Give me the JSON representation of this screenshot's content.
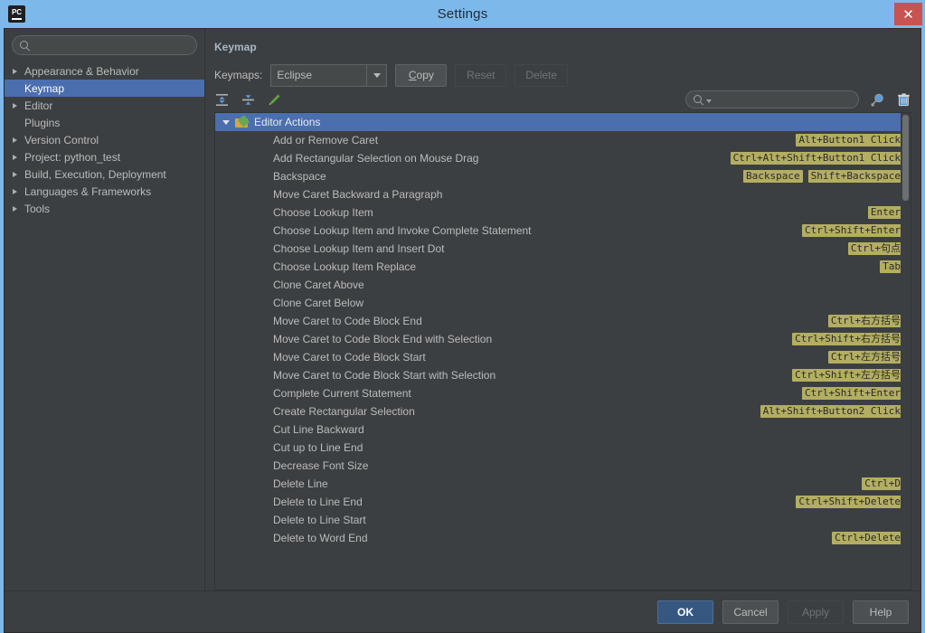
{
  "window": {
    "title": "Settings",
    "app_icon": "PC",
    "close_label": "✕"
  },
  "sidebar": {
    "search": {
      "value": "",
      "placeholder": ""
    },
    "items": [
      {
        "label": "Appearance & Behavior",
        "arrow": true,
        "selected": false
      },
      {
        "label": "Keymap",
        "arrow": false,
        "selected": true
      },
      {
        "label": "Editor",
        "arrow": true,
        "selected": false
      },
      {
        "label": "Plugins",
        "arrow": false,
        "selected": false
      },
      {
        "label": "Version Control",
        "arrow": true,
        "selected": false
      },
      {
        "label": "Project: python_test",
        "arrow": true,
        "selected": false
      },
      {
        "label": "Build, Execution, Deployment",
        "arrow": true,
        "selected": false
      },
      {
        "label": "Languages & Frameworks",
        "arrow": true,
        "selected": false
      },
      {
        "label": "Tools",
        "arrow": true,
        "selected": false
      }
    ]
  },
  "main": {
    "panel_title": "Keymap",
    "keymaps_label": "Keymaps:",
    "keymap_selected": "Eclipse",
    "buttons": {
      "copy_mnemonic": "C",
      "copy_rest": "opy",
      "reset": "Reset",
      "delete": "Delete"
    },
    "toolbar_icons": [
      "expand-all-icon",
      "collapse-all-icon",
      "edit-shortcut-icon"
    ],
    "tree_search": {
      "value": "",
      "placeholder": ""
    },
    "right_icons": [
      "find-by-shortcut-icon",
      "delete-shortcut-icon"
    ]
  },
  "tree": {
    "group": {
      "label": "Editor Actions",
      "expanded": true
    },
    "rows": [
      {
        "label": "Add or Remove Caret",
        "shortcuts": [
          "Alt+Button1 Click"
        ]
      },
      {
        "label": "Add Rectangular Selection on Mouse Drag",
        "shortcuts": [
          "Ctrl+Alt+Shift+Button1 Click"
        ]
      },
      {
        "label": "Backspace",
        "shortcuts": [
          "Backspace",
          "Shift+Backspace"
        ]
      },
      {
        "label": "Move Caret Backward a Paragraph",
        "shortcuts": []
      },
      {
        "label": "Choose Lookup Item",
        "shortcuts": [
          "Enter"
        ]
      },
      {
        "label": "Choose Lookup Item and Invoke Complete Statement",
        "shortcuts": [
          "Ctrl+Shift+Enter"
        ]
      },
      {
        "label": "Choose Lookup Item and Insert Dot",
        "shortcuts": [
          "Ctrl+句点"
        ]
      },
      {
        "label": "Choose Lookup Item Replace",
        "shortcuts": [
          "Tab"
        ]
      },
      {
        "label": "Clone Caret Above",
        "shortcuts": []
      },
      {
        "label": "Clone Caret Below",
        "shortcuts": []
      },
      {
        "label": "Move Caret to Code Block End",
        "shortcuts": [
          "Ctrl+右方括号"
        ]
      },
      {
        "label": "Move Caret to Code Block End with Selection",
        "shortcuts": [
          "Ctrl+Shift+右方括号"
        ]
      },
      {
        "label": "Move Caret to Code Block Start",
        "shortcuts": [
          "Ctrl+左方括号"
        ]
      },
      {
        "label": "Move Caret to Code Block Start with Selection",
        "shortcuts": [
          "Ctrl+Shift+左方括号"
        ]
      },
      {
        "label": "Complete Current Statement",
        "shortcuts": [
          "Ctrl+Shift+Enter"
        ]
      },
      {
        "label": "Create Rectangular Selection",
        "shortcuts": [
          "Alt+Shift+Button2 Click"
        ]
      },
      {
        "label": "Cut Line Backward",
        "shortcuts": []
      },
      {
        "label": "Cut up to Line End",
        "shortcuts": []
      },
      {
        "label": "Decrease Font Size",
        "shortcuts": []
      },
      {
        "label": "Delete Line",
        "shortcuts": [
          "Ctrl+D"
        ]
      },
      {
        "label": "Delete to Line End",
        "shortcuts": [
          "Ctrl+Shift+Delete"
        ]
      },
      {
        "label": "Delete to Line Start",
        "shortcuts": []
      },
      {
        "label": "Delete to Word End",
        "shortcuts": [
          "Ctrl+Delete"
        ]
      }
    ]
  },
  "footer": {
    "ok": "OK",
    "cancel": "Cancel",
    "apply": "Apply",
    "help": "Help"
  },
  "colors": {
    "titlebar": "#7cb9ea",
    "close": "#c75450",
    "panel": "#3c3f41",
    "selection": "#4b6eaf",
    "badge": "#b3ae60",
    "default_button": "#365880"
  }
}
